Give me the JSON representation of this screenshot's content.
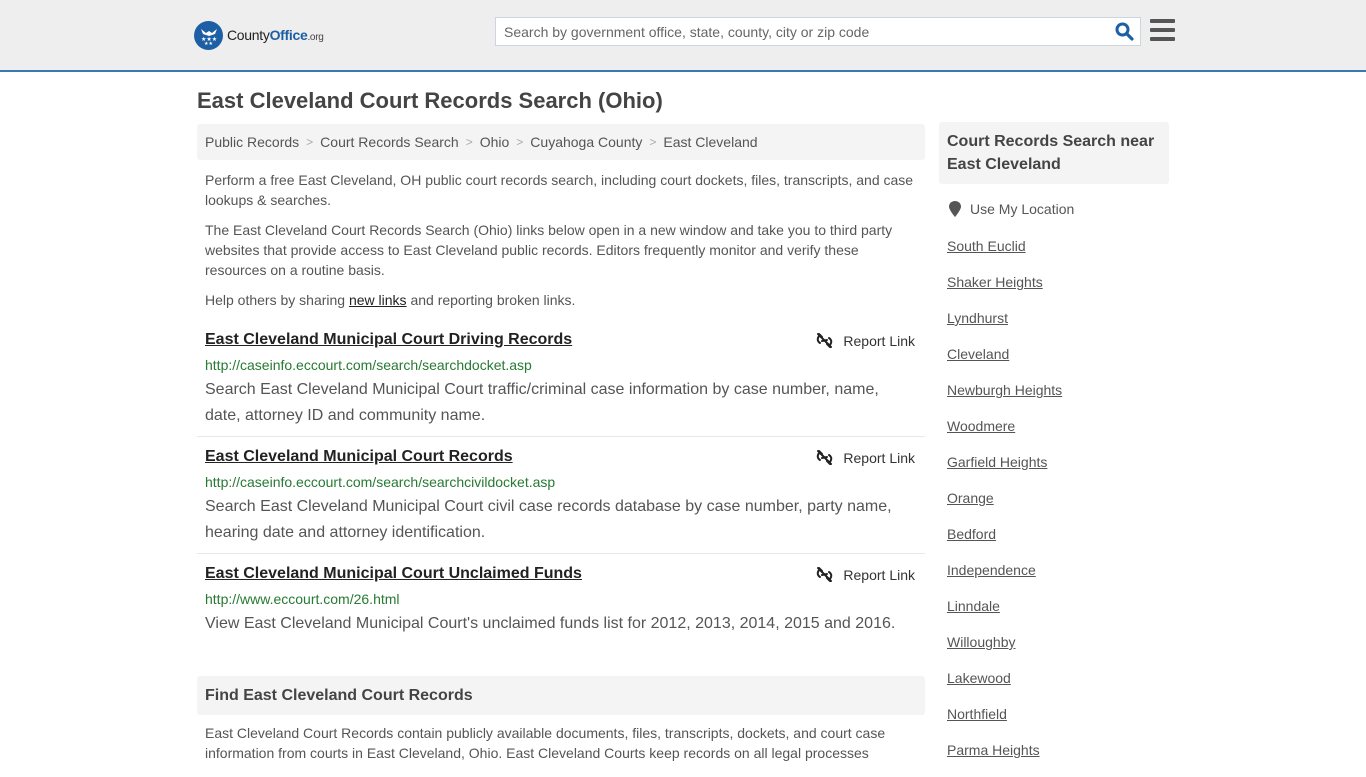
{
  "header": {
    "logo": {
      "county": "County",
      "office": "Office",
      "org": ".org"
    },
    "search_placeholder": "Search by government office, state, county, city or zip code",
    "search_value": "",
    "search_icon": "search-icon",
    "menu_icon": "hamburger-menu-icon",
    "brand_color": "#1d5fa5",
    "border_color": "#3a7ab0"
  },
  "page": {
    "title": "East Cleveland Court Records Search (Ohio)"
  },
  "breadcrumb": [
    {
      "label": "Public Records"
    },
    {
      "label": "Court Records Search"
    },
    {
      "label": "Ohio"
    },
    {
      "label": "Cuyahoga County"
    },
    {
      "label": "East Cleveland"
    }
  ],
  "breadcrumb_separator": ">",
  "intro": {
    "p1": "Perform a free East Cleveland, OH public court records search, including court dockets, files, transcripts, and case lookups & searches.",
    "p2": "The East Cleveland Court Records Search (Ohio) links below open in a new window and take you to third party websites that provide access to East Cleveland public records. Editors frequently monitor and verify these resources on a routine basis.",
    "p3_before": "Help others by sharing ",
    "p3_link": "new links",
    "p3_after": " and reporting broken links."
  },
  "results": [
    {
      "title": "East Cleveland Municipal Court Driving Records",
      "url": "http://caseinfo.eccourt.com/search/searchdocket.asp",
      "description": "Search East Cleveland Municipal Court traffic/criminal case information by case number, name, date, attorney ID and community name.",
      "report_label": "Report Link"
    },
    {
      "title": "East Cleveland Municipal Court Records",
      "url": "http://caseinfo.eccourt.com/search/searchcivildocket.asp",
      "description": "Search East Cleveland Municipal Court civil case records database by case number, party name, hearing date and attorney identification.",
      "report_label": "Report Link"
    },
    {
      "title": "East Cleveland Municipal Court Unclaimed Funds",
      "url": "http://www.eccourt.com/26.html",
      "description": "View East Cleveland Municipal Court's unclaimed funds list for 2012, 2013, 2014, 2015 and 2016.",
      "report_label": "Report Link"
    }
  ],
  "find_section": {
    "heading": "Find East Cleveland Court Records",
    "body": "East Cleveland Court Records contain publicly available documents, files, transcripts, dockets, and court case information from courts in East Cleveland, Ohio. East Cleveland Courts keep records on all legal processes"
  },
  "sidebar": {
    "heading": "Court Records Search near East Cleveland",
    "use_location": "Use My Location",
    "nearby": [
      "South Euclid",
      "Shaker Heights",
      "Lyndhurst",
      "Cleveland",
      "Newburgh Heights",
      "Woodmere",
      "Garfield Heights",
      "Orange",
      "Bedford",
      "Independence",
      "Linndale",
      "Willoughby",
      "Lakewood",
      "Northfield",
      "Parma Heights"
    ]
  },
  "colors": {
    "url_green": "#267a32",
    "link_dark": "#222222",
    "text": "#555555"
  }
}
